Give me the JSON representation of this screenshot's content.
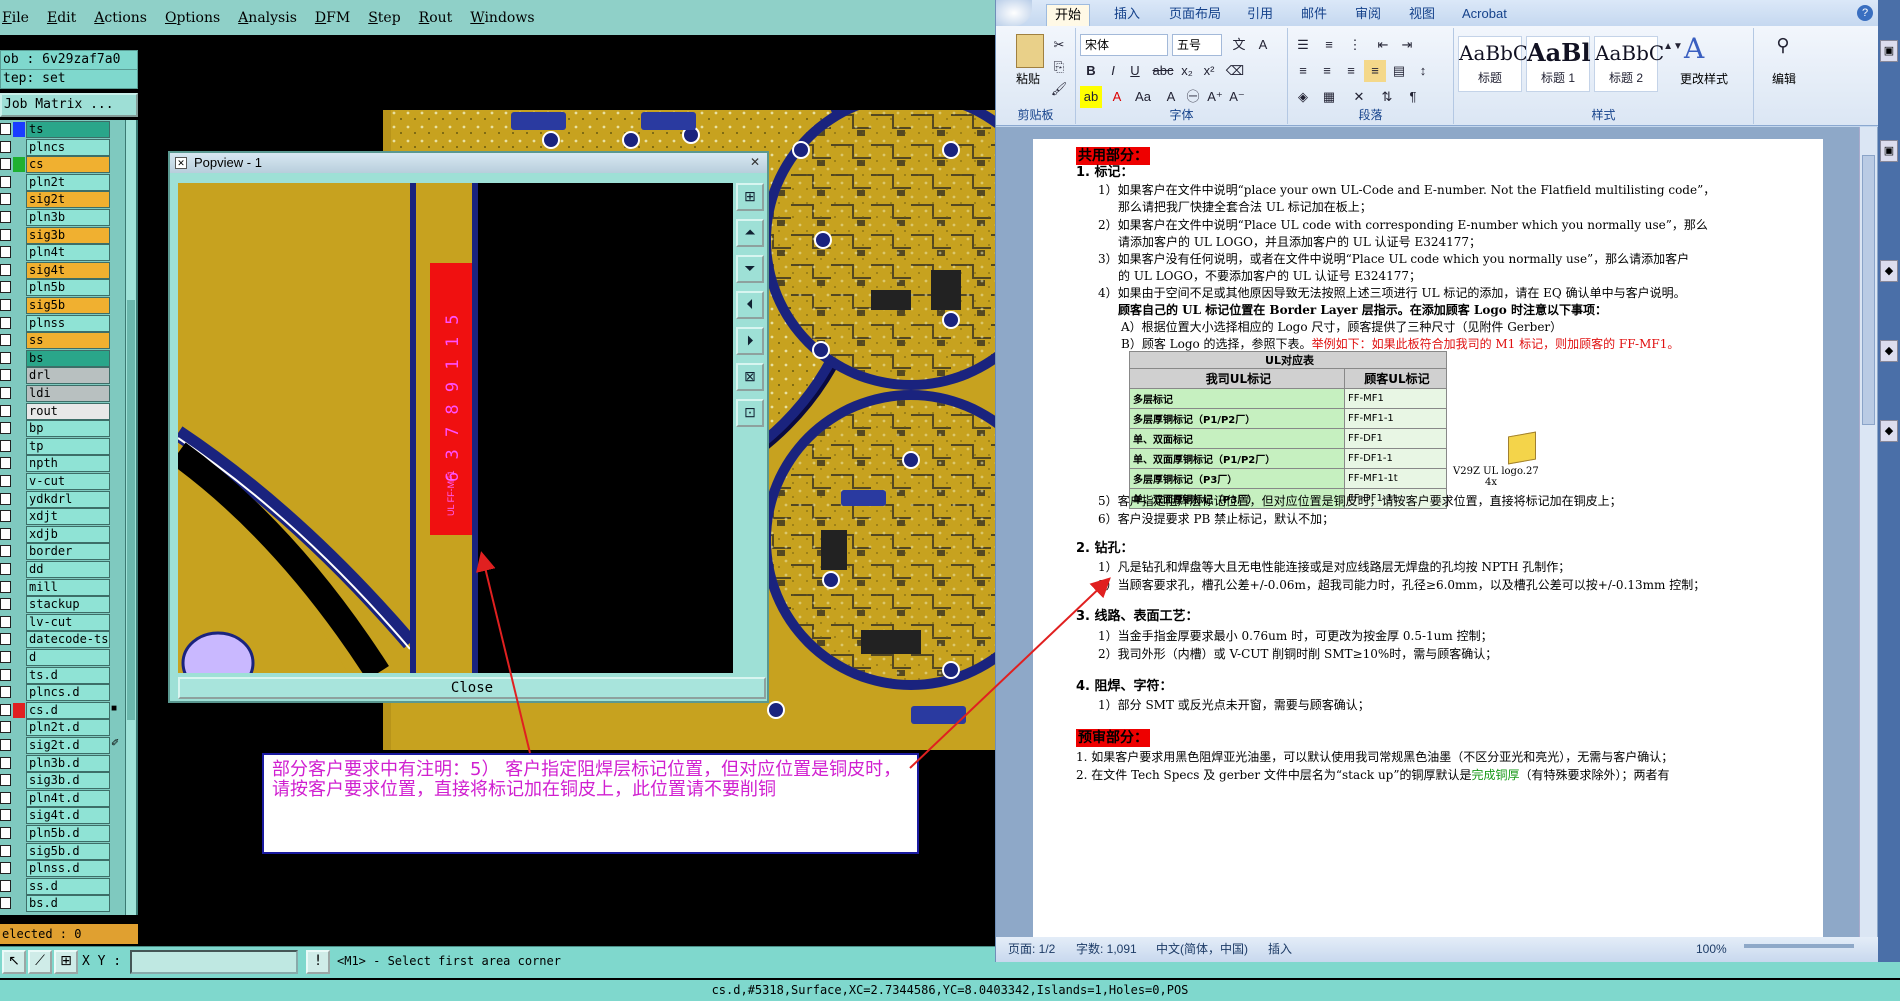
{
  "cam": {
    "menu": [
      "File",
      "Edit",
      "Actions",
      "Options",
      "Analysis",
      "DFM",
      "Step",
      "Rout",
      "Windows"
    ],
    "job_label": "ob : 6v29zaf7a0",
    "step_label": "tep: set",
    "matrix_button": "Job Matrix ...",
    "layers": [
      {
        "name": "ts",
        "color": "#1a3cff",
        "bg": "#2aa68a"
      },
      {
        "name": "plncs",
        "color": "",
        "bg": "#8fe3d5"
      },
      {
        "name": "cs",
        "color": "#1fb030",
        "bg": "#f0b030"
      },
      {
        "name": "pln2t",
        "color": "",
        "bg": "#8fe3d5"
      },
      {
        "name": "sig2t",
        "color": "",
        "bg": "#f0b030"
      },
      {
        "name": "pln3b",
        "color": "",
        "bg": "#8fe3d5"
      },
      {
        "name": "sig3b",
        "color": "",
        "bg": "#f0b030"
      },
      {
        "name": "pln4t",
        "color": "",
        "bg": "#8fe3d5"
      },
      {
        "name": "sig4t",
        "color": "",
        "bg": "#f0b030"
      },
      {
        "name": "pln5b",
        "color": "",
        "bg": "#8fe3d5"
      },
      {
        "name": "sig5b",
        "color": "",
        "bg": "#f0b030"
      },
      {
        "name": "plnss",
        "color": "",
        "bg": "#8fe3d5"
      },
      {
        "name": "ss",
        "color": "",
        "bg": "#f0b030"
      },
      {
        "name": "bs",
        "color": "",
        "bg": "#2aa68a"
      },
      {
        "name": "drl",
        "color": "",
        "bg": "#b8c0c0"
      },
      {
        "name": "ldi",
        "color": "",
        "bg": "#b8c0c0"
      },
      {
        "name": "rout",
        "color": "",
        "bg": "#e8e8e8"
      },
      {
        "name": "bp",
        "color": "",
        "bg": "#8fe3d5"
      },
      {
        "name": "tp",
        "color": "",
        "bg": "#8fe3d5"
      },
      {
        "name": "npth",
        "color": "",
        "bg": "#8fe3d5"
      },
      {
        "name": "v-cut",
        "color": "",
        "bg": "#8fe3d5"
      },
      {
        "name": "ydkdrl",
        "color": "",
        "bg": "#8fe3d5"
      },
      {
        "name": "xdjt",
        "color": "",
        "bg": "#8fe3d5"
      },
      {
        "name": "xdjb",
        "color": "",
        "bg": "#8fe3d5"
      },
      {
        "name": "border",
        "color": "",
        "bg": "#8fe3d5"
      },
      {
        "name": "dd",
        "color": "",
        "bg": "#8fe3d5"
      },
      {
        "name": "mill",
        "color": "",
        "bg": "#8fe3d5"
      },
      {
        "name": "stackup",
        "color": "",
        "bg": "#8fe3d5"
      },
      {
        "name": "lv-cut",
        "color": "",
        "bg": "#8fe3d5"
      },
      {
        "name": "datecode-ts",
        "color": "",
        "bg": "#8fe3d5"
      },
      {
        "name": "d",
        "color": "",
        "bg": "#8fe3d5"
      },
      {
        "name": "ts.d",
        "color": "",
        "bg": "#8fe3d5"
      },
      {
        "name": "plncs.d",
        "color": "",
        "bg": "#8fe3d5"
      },
      {
        "name": "cs.d",
        "color": "#e02020",
        "bg": "#8fe3d5",
        "mark": "■"
      },
      {
        "name": "pln2t.d",
        "color": "",
        "bg": "#8fe3d5"
      },
      {
        "name": "sig2t.d",
        "color": "",
        "bg": "#8fe3d5",
        "mark": "✐"
      },
      {
        "name": "pln3b.d",
        "color": "",
        "bg": "#8fe3d5"
      },
      {
        "name": "sig3b.d",
        "color": "",
        "bg": "#8fe3d5"
      },
      {
        "name": "pln4t.d",
        "color": "",
        "bg": "#8fe3d5"
      },
      {
        "name": "sig4t.d",
        "color": "",
        "bg": "#8fe3d5"
      },
      {
        "name": "pln5b.d",
        "color": "",
        "bg": "#8fe3d5"
      },
      {
        "name": "sig5b.d",
        "color": "",
        "bg": "#8fe3d5"
      },
      {
        "name": "plnss.d",
        "color": "",
        "bg": "#8fe3d5"
      },
      {
        "name": "ss.d",
        "color": "",
        "bg": "#8fe3d5"
      },
      {
        "name": "bs.d",
        "color": "",
        "bg": "#8fe3d5"
      }
    ],
    "selected_label": "elected : 0",
    "xy_label": "X Y :",
    "xy_value": "",
    "prompt": "<M1> - Select first area corner",
    "status": "cs.d,#5318,Surface,XC=2.7344586,YC=8.0403342,Islands=1,Holes=0,POS",
    "popview": {
      "title": "Popview - 1",
      "close_label": "Close",
      "logo_text": "6 3 7  8 9 1 1 5",
      "logo_small": "UL FF-MF1"
    },
    "note": "部分客户要求中有注明：5） 客户指定阻焊层标记位置，但对应位置是铜皮时，请按客户要求位置，直接将标记加在铜皮上，此位置请不要削铜"
  },
  "word": {
    "tabs": [
      "开始",
      "插入",
      "页面布局",
      "引用",
      "邮件",
      "审阅",
      "视图",
      "Acrobat"
    ],
    "font_name": "宋体",
    "font_size": "五号",
    "groups": [
      "剪贴板",
      "字体",
      "段落",
      "样式",
      "编辑"
    ],
    "paste_label": "粘贴",
    "styles": [
      {
        "preview": "AaBbC",
        "name": "标题"
      },
      {
        "preview": "AaBl",
        "name": "标题 1"
      },
      {
        "preview": "AaBbC",
        "name": "标题 2"
      }
    ],
    "change_styles": "更改样式",
    "edit_label": "编辑",
    "status": {
      "page": "页面: 1/2",
      "words": "字数: 1,091",
      "lang": "中文(简体，中国)",
      "mode": "插入",
      "zoom": "100%"
    },
    "doc": {
      "h1": "共用部分：",
      "s1": "1.  标记：",
      "l1a": "1）如果客户在文件中说明“place your own UL-Code and E-number. Not the Flatfield multilisting code”，",
      "l1b": "那么请把我厂快捷全套合法 UL 标记加在板上；",
      "l2a": "2）如果客户在文件中说明“Place UL code with corresponding E-number which you normally use”，那么",
      "l2b": "请添加客户的 UL LOGO，并且添加客户的 UL 认证号 E324177；",
      "l3a": "3）如果客户没有任何说明，或者在文件中说明“Place UL code which you normally use”，那么请添加客户",
      "l3b": "的 UL LOGO，不要添加客户的 UL 认证号 E324177；",
      "l4a": "4）如果由于空间不足或其他原因导致无法按照上述三项进行 UL 标记的添加，请在 EQ 确认单中与客户说明。",
      "l4b": "顾客自己的 UL 标记位置在 Border Layer 层指示。在添加顾客 Logo 时注意以下事项：",
      "l4c": "A）根据位置大小选择相应的 Logo 尺寸，顾客提供了三种尺寸（见附件 Gerber）",
      "l4d": "B）顾客 Logo 的选择，参照下表。",
      "l4d_red": "举例如下：如果此板符合加我司的 M1 标记，则加顾客的 FF-MF1。",
      "table_caption": "UL对应表",
      "table_headers": [
        "我司UL标记",
        "顾客UL标记"
      ],
      "table_rows": [
        [
          "多层标记",
          "FF-MF1"
        ],
        [
          "多层厚铜标记（P1/P2厂）",
          "FF-MF1-1"
        ],
        [
          "单、双面标记",
          "FF-DF1"
        ],
        [
          "单、双面厚铜标记（P1/P2厂）",
          "FF-DF1-1"
        ],
        [
          "多层厚铜标记（P3厂）",
          "FF-MF1-1t"
        ],
        [
          "单、双面厚铜标记（P3厂）",
          "FF-DF1-1t"
        ]
      ],
      "attachment_name": "V29Z  UL logo.27",
      "attachment_sub": "4x",
      "l5": "5）客户指定阻焊层标记位置，但对应位置是铜皮时，请按客户要求位置，直接将标记加在铜皮上；",
      "l6": "6）客户没提要求 PB 禁止标记，默认不加；",
      "s2": "2.  钻孔：",
      "d1": "1）凡是钻孔和焊盘等大且无电性能连接或是对应线路层无焊盘的孔均按 NPTH 孔制作；",
      "d2": "2）当顾客要求孔，槽孔公差+/-0.06m，超我司能力时，孔径≥6.0mm，以及槽孔公差可以按+/-0.13mm 控制；",
      "s3": "3.  线路、表面工艺：",
      "t1": "1）当金手指金厚要求最小 0.76um 时，可更改为按金厚 0.5-1um 控制；",
      "t2": "2）我司外形（内槽）或 V-CUT 削铜时削 SMT≥10%时，需与顾客确认；",
      "s4": "4.  阻焊、字符：",
      "m1": "1）部分 SMT 或反光点未开窗，需要与顾客确认；",
      "h2": "预审部分：",
      "p1": "1.  如果客户要求用黑色阻焊亚光油墨，可以默认使用我司常规黑色油墨（不区分亚光和亮光），无需与客户确认；",
      "p2a": "2.  在文件 Tech Specs 及 gerber 文件中层名为“stack up”的铜厚默认是",
      "p2g": "完成铜厚",
      "p2b": "（有特殊要求除外）；两者有"
    }
  }
}
